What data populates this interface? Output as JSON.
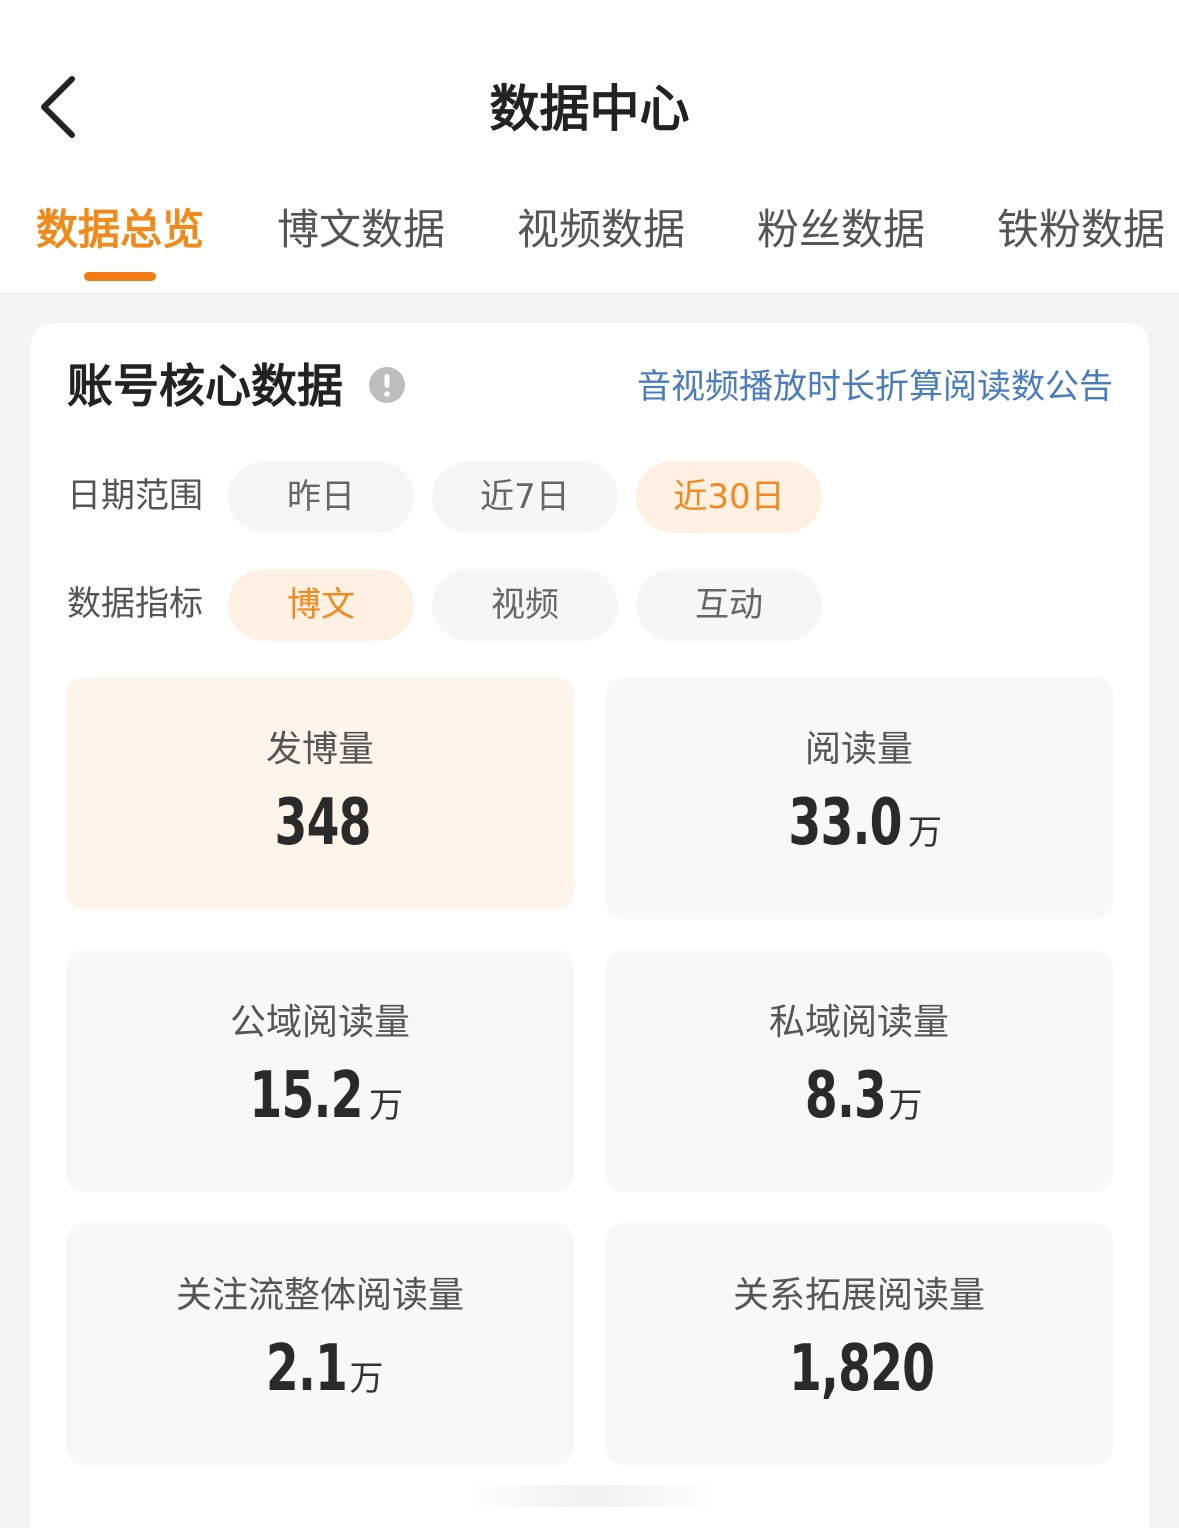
{
  "header": {
    "title": "数据中心",
    "back_icon": "chevron-left-icon"
  },
  "tabs": [
    {
      "label": "数据总览",
      "active": true
    },
    {
      "label": "博文数据",
      "active": false
    },
    {
      "label": "视频数据",
      "active": false
    },
    {
      "label": "粉丝数据",
      "active": false
    },
    {
      "label": "铁粉数据",
      "active": false
    }
  ],
  "core": {
    "title": "账号核心数据",
    "info_icon": "exclamation-circle-icon",
    "notice_link": "音视频播放时长折算阅读数公告"
  },
  "date_range": {
    "label": "日期范围",
    "options": [
      "昨日",
      "近7日",
      "近30日"
    ],
    "selected": "近30日"
  },
  "metric": {
    "label": "数据指标",
    "options": [
      "博文",
      "视频",
      "互动"
    ],
    "selected": "博文"
  },
  "stats": [
    {
      "label": "发博量",
      "value": "348",
      "unit": ""
    },
    {
      "label": "阅读量",
      "value": "33.0",
      "unit": "万"
    },
    {
      "label": "公域阅读量",
      "value": "15.2",
      "unit": "万"
    },
    {
      "label": "私域阅读量",
      "value": "8.3",
      "unit": "万"
    },
    {
      "label": "关注流整体阅读量",
      "value": "2.1",
      "unit": "万"
    },
    {
      "label": "关系拓展阅读量",
      "value": "1,820",
      "unit": ""
    }
  ],
  "colors": {
    "accent": "#f08a1c",
    "link": "#4a7cc0",
    "active_pill_bg": "#fef1e4",
    "highlight_card_bg": "#fff4ea"
  }
}
